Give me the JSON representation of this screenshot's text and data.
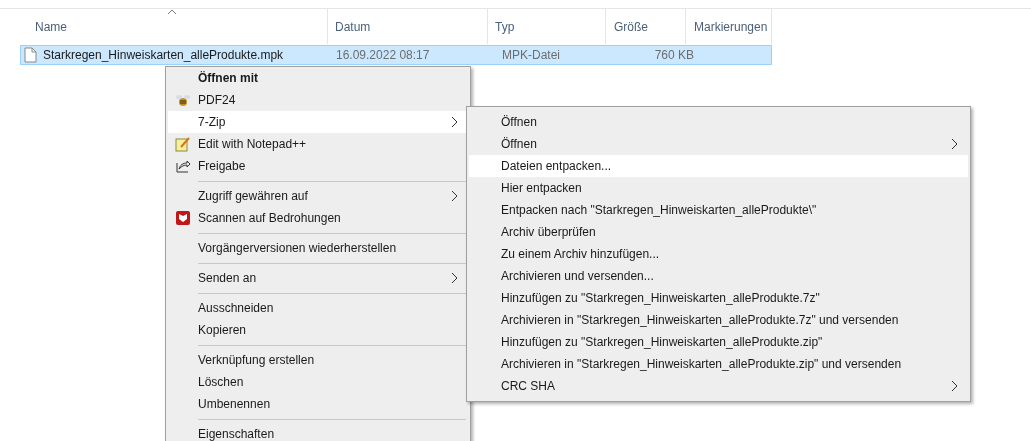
{
  "columns": [
    {
      "label": "Name",
      "sorted": true
    },
    {
      "label": "Datum",
      "sorted": false
    },
    {
      "label": "Typ",
      "sorted": false
    },
    {
      "label": "Größe",
      "sorted": false
    },
    {
      "label": "Markierungen",
      "sorted": false
    }
  ],
  "files": [
    {
      "name": "Starkregen_Hinweiskarten_alleProdukte.mpk",
      "date": "16.09.2022 08:17",
      "type": "MPK-Datei",
      "size": "760 KB",
      "selected": true
    }
  ],
  "context_menu": [
    {
      "kind": "item",
      "label": "Öffnen mit",
      "default": true,
      "submenu": false,
      "selected": false
    },
    {
      "kind": "bee",
      "label": "PDF24",
      "default": false,
      "submenu": false,
      "selected": false
    },
    {
      "kind": "item",
      "label": "7-Zip",
      "default": false,
      "submenu": true,
      "selected": true
    },
    {
      "kind": "notepad",
      "label": "Edit with Notepad++",
      "default": false,
      "submenu": false,
      "selected": false
    },
    {
      "kind": "share",
      "label": "Freigabe",
      "default": false,
      "submenu": false,
      "selected": false
    },
    {
      "kind": "separator"
    },
    {
      "kind": "item",
      "label": "Zugriff gewähren auf",
      "default": false,
      "submenu": true,
      "selected": false
    },
    {
      "kind": "shield",
      "label": "Scannen auf Bedrohungen",
      "default": false,
      "submenu": false,
      "selected": false
    },
    {
      "kind": "separator"
    },
    {
      "kind": "item",
      "label": "Vorgängerversionen wiederherstellen",
      "default": false,
      "submenu": false,
      "selected": false
    },
    {
      "kind": "separator"
    },
    {
      "kind": "item",
      "label": "Senden an",
      "default": false,
      "submenu": true,
      "selected": false
    },
    {
      "kind": "separator"
    },
    {
      "kind": "item",
      "label": "Ausschneiden",
      "default": false,
      "submenu": false,
      "selected": false
    },
    {
      "kind": "item",
      "label": "Kopieren",
      "default": false,
      "submenu": false,
      "selected": false
    },
    {
      "kind": "separator"
    },
    {
      "kind": "item",
      "label": "Verknüpfung erstellen",
      "default": false,
      "submenu": false,
      "selected": false
    },
    {
      "kind": "item",
      "label": "Löschen",
      "default": false,
      "submenu": false,
      "selected": false
    },
    {
      "kind": "item",
      "label": "Umbenennen",
      "default": false,
      "submenu": false,
      "selected": false
    },
    {
      "kind": "separator"
    },
    {
      "kind": "item",
      "label": "Eigenschaften",
      "default": false,
      "submenu": false,
      "selected": false
    }
  ],
  "submenu_7zip": [
    {
      "label": "Öffnen",
      "submenu": false,
      "selected": false
    },
    {
      "label": "Öffnen",
      "submenu": true,
      "selected": false
    },
    {
      "label": "Dateien entpacken...",
      "submenu": false,
      "selected": true
    },
    {
      "label": "Hier entpacken",
      "submenu": false,
      "selected": false
    },
    {
      "label": "Entpacken nach \"Starkregen_Hinweiskarten_alleProdukte\\\"",
      "submenu": false,
      "selected": false
    },
    {
      "label": "Archiv überprüfen",
      "submenu": false,
      "selected": false
    },
    {
      "label": "Zu einem Archiv hinzufügen...",
      "submenu": false,
      "selected": false
    },
    {
      "label": "Archivieren und versenden...",
      "submenu": false,
      "selected": false
    },
    {
      "label": "Hinzufügen zu \"Starkregen_Hinweiskarten_alleProdukte.7z\"",
      "submenu": false,
      "selected": false
    },
    {
      "label": "Archivieren in \"Starkregen_Hinweiskarten_alleProdukte.7z\" und versenden",
      "submenu": false,
      "selected": false
    },
    {
      "label": "Hinzufügen zu \"Starkregen_Hinweiskarten_alleProdukte.zip\"",
      "submenu": false,
      "selected": false
    },
    {
      "label": "Archivieren in \"Starkregen_Hinweiskarten_alleProdukte.zip\" und versenden",
      "submenu": false,
      "selected": false
    },
    {
      "label": "CRC SHA",
      "submenu": true,
      "selected": false
    }
  ]
}
